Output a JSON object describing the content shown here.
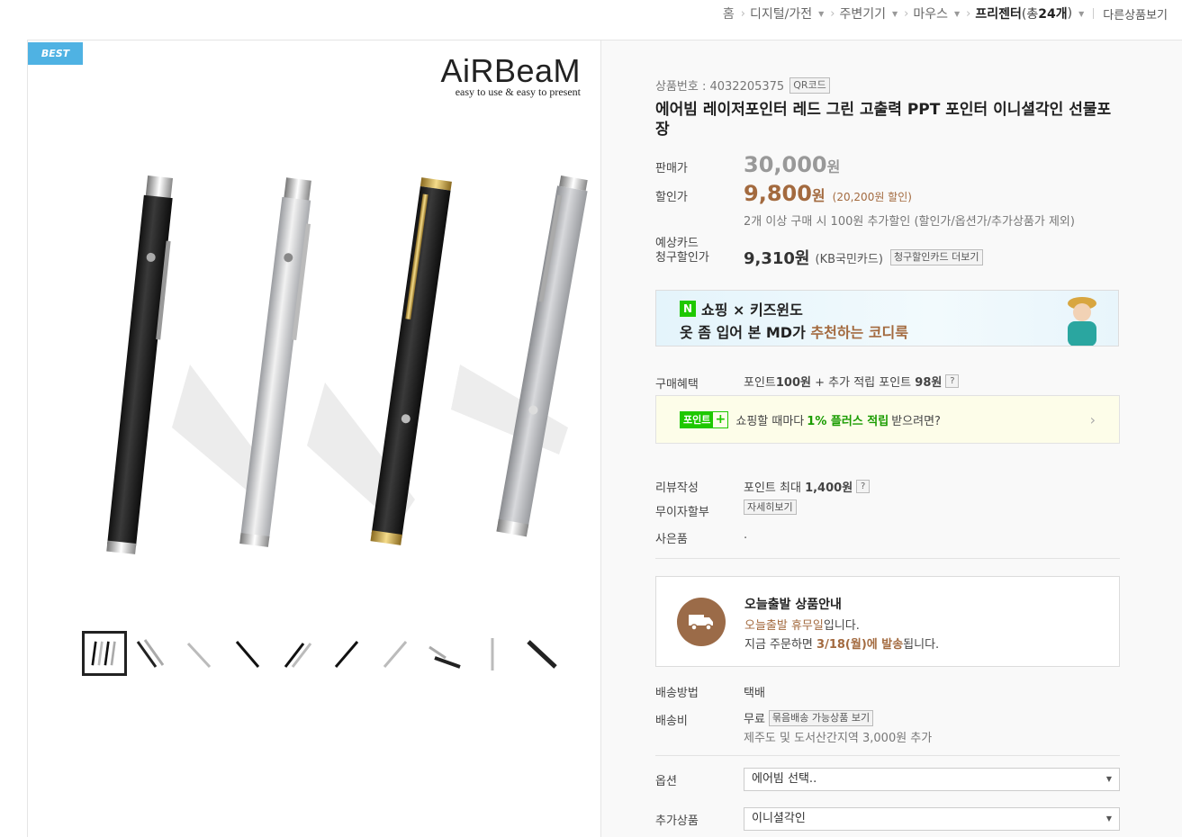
{
  "breadcrumb": {
    "home": "홈",
    "items": [
      "디지털/가전",
      "주변기기",
      "마우스"
    ],
    "current": "프리젠터",
    "count_prefix": "(총 ",
    "count": "24개",
    "count_suffix": ")",
    "other": "다른상품보기"
  },
  "gallery": {
    "badge": "BEST",
    "brand_name": "AiRBeaM",
    "brand_tagline": "easy to use & easy to present",
    "thumb_count": 10
  },
  "product": {
    "number_label": "상품번호 : 4032205375",
    "qr_label": "QR코드",
    "title": "에어빔 레이저포인터 레드 그린 고출력 PPT 포인터 이니셜각인 선물포장",
    "price_label": "판매가",
    "price": "30,000",
    "won": "원",
    "sale_label": "할인가",
    "sale_price": "9,800",
    "sale_discount": "(20,200원 할인)",
    "extra_discount": "2개 이상 구매 시 100원 추가할인 (할인가/옵션가/추가상품가 제외)",
    "card_label_1": "예상카드",
    "card_label_2": "청구할인가",
    "card_price": "9,310원",
    "card_name": "(KB국민카드)",
    "card_more": "청구할인카드 더보기"
  },
  "banner": {
    "logo": "N",
    "line1": "쇼핑 × 키즈윈도",
    "line2_pre": "옷 좀 입어 본 MD가 ",
    "line2_hl": "추천하는 코디룩"
  },
  "benefit": {
    "label": "구매혜택",
    "text_1": "포인트 ",
    "point_1": "100원",
    "text_2": " + 추가 적립 포인트 ",
    "point_2": "98원",
    "help": "?"
  },
  "point_plus": {
    "badge": "포인트",
    "badge_plus": "+",
    "text_pre": "쇼핑할 때마다",
    "text_hl": "1% 플러스 적립",
    "text_post": "받으려면?",
    "arrow": "›"
  },
  "review": {
    "label": "리뷰작성",
    "text": "포인트 최대 ",
    "amount": "1,400원",
    "help": "?"
  },
  "installment": {
    "label": "무이자할부",
    "button": "자세히보기"
  },
  "gift": {
    "label": "사은품",
    "value": "."
  },
  "shipping_notice": {
    "title": "오늘출발 상품안내",
    "line2_hl": "오늘출발 휴무일",
    "line2_post": "입니다.",
    "line3_pre": "지금 주문하면 ",
    "line3_hl": "3/18(월)에 발송",
    "line3_post": "됩니다."
  },
  "delivery": {
    "method_label": "배송방법",
    "method": "택배",
    "fee_label": "배송비",
    "fee": "무료",
    "bundle_button": "묶음배송 가능상품 보기",
    "note": "제주도 및 도서산간지역 3,000원 추가"
  },
  "options": {
    "option_label": "옵션",
    "option_value": "에어빔 선택..",
    "addon_label": "추가상품",
    "addon_value": "이니셜각인"
  },
  "colors": {
    "accent_brown": "#a36a3f",
    "naver_green": "#1ec800",
    "best_blue": "#4fb2e3"
  }
}
